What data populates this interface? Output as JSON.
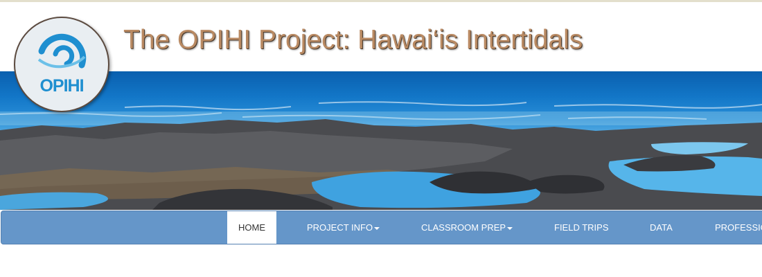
{
  "site": {
    "title": "The OPIHI Project: Hawai‘is Intertidals",
    "logo_text": "OPIHI"
  },
  "nav": {
    "items": [
      {
        "label": "HOME",
        "active": true,
        "dropdown": false
      },
      {
        "label": "PROJECT INFO",
        "active": false,
        "dropdown": true
      },
      {
        "label": "CLASSROOM PREP",
        "active": false,
        "dropdown": true
      },
      {
        "label": "FIELD TRIPS",
        "active": false,
        "dropdown": false
      },
      {
        "label": "DATA",
        "active": false,
        "dropdown": false
      },
      {
        "label": "PROFESSIO",
        "active": false,
        "dropdown": false
      }
    ]
  },
  "colors": {
    "title": "#b98a63",
    "navbar": "#6596c9",
    "logo_blue": "#1f8fd0"
  }
}
